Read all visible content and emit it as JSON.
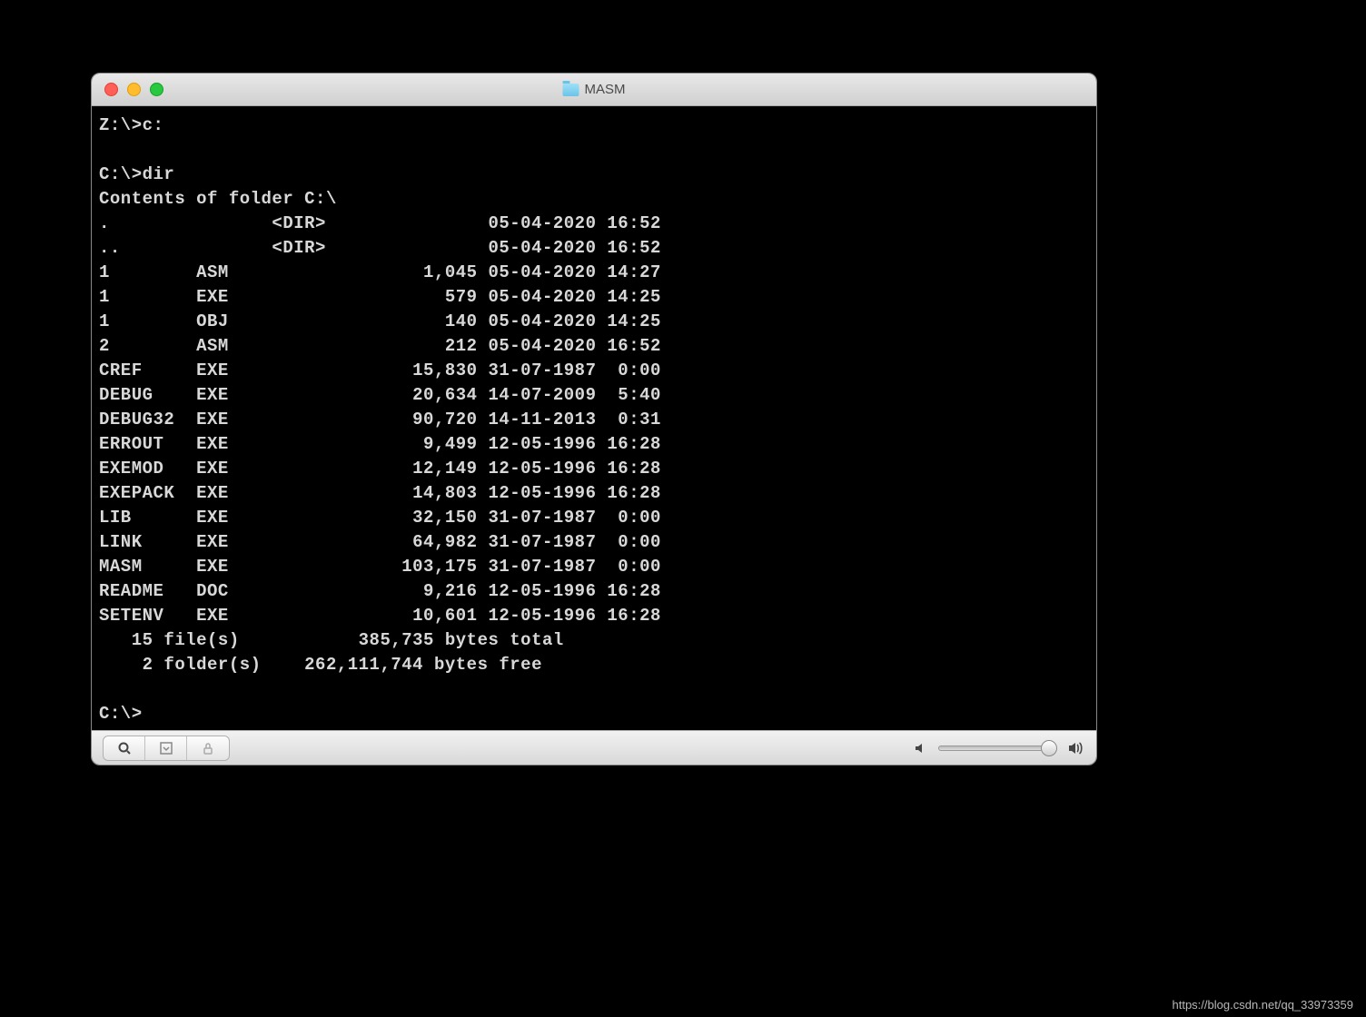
{
  "window": {
    "title": "MASM"
  },
  "terminal": {
    "prompt1": "Z:\\>c:",
    "prompt2": "C:\\>dir",
    "header": "Contents of folder C:\\",
    "entries": [
      {
        "name": ".",
        "ext": "",
        "dir": true,
        "size": "",
        "date": "05-04-2020",
        "time": "16:52"
      },
      {
        "name": "..",
        "ext": "",
        "dir": true,
        "size": "",
        "date": "05-04-2020",
        "time": "16:52"
      },
      {
        "name": "1",
        "ext": "ASM",
        "dir": false,
        "size": "1,045",
        "date": "05-04-2020",
        "time": "14:27"
      },
      {
        "name": "1",
        "ext": "EXE",
        "dir": false,
        "size": "579",
        "date": "05-04-2020",
        "time": "14:25"
      },
      {
        "name": "1",
        "ext": "OBJ",
        "dir": false,
        "size": "140",
        "date": "05-04-2020",
        "time": "14:25"
      },
      {
        "name": "2",
        "ext": "ASM",
        "dir": false,
        "size": "212",
        "date": "05-04-2020",
        "time": "16:52"
      },
      {
        "name": "CREF",
        "ext": "EXE",
        "dir": false,
        "size": "15,830",
        "date": "31-07-1987",
        "time": " 0:00"
      },
      {
        "name": "DEBUG",
        "ext": "EXE",
        "dir": false,
        "size": "20,634",
        "date": "14-07-2009",
        "time": " 5:40"
      },
      {
        "name": "DEBUG32",
        "ext": "EXE",
        "dir": false,
        "size": "90,720",
        "date": "14-11-2013",
        "time": " 0:31"
      },
      {
        "name": "ERROUT",
        "ext": "EXE",
        "dir": false,
        "size": "9,499",
        "date": "12-05-1996",
        "time": "16:28"
      },
      {
        "name": "EXEMOD",
        "ext": "EXE",
        "dir": false,
        "size": "12,149",
        "date": "12-05-1996",
        "time": "16:28"
      },
      {
        "name": "EXEPACK",
        "ext": "EXE",
        "dir": false,
        "size": "14,803",
        "date": "12-05-1996",
        "time": "16:28"
      },
      {
        "name": "LIB",
        "ext": "EXE",
        "dir": false,
        "size": "32,150",
        "date": "31-07-1987",
        "time": " 0:00"
      },
      {
        "name": "LINK",
        "ext": "EXE",
        "dir": false,
        "size": "64,982",
        "date": "31-07-1987",
        "time": " 0:00"
      },
      {
        "name": "MASM",
        "ext": "EXE",
        "dir": false,
        "size": "103,175",
        "date": "31-07-1987",
        "time": " 0:00"
      },
      {
        "name": "README",
        "ext": "DOC",
        "dir": false,
        "size": "9,216",
        "date": "12-05-1996",
        "time": "16:28"
      },
      {
        "name": "SETENV",
        "ext": "EXE",
        "dir": false,
        "size": "10,601",
        "date": "12-05-1996",
        "time": "16:28"
      }
    ],
    "summary1_count": "15",
    "summary1_label": "file(s)",
    "summary1_bytes": "385,735",
    "summary1_tail": "bytes total",
    "summary2_count": "2",
    "summary2_label": "folder(s)",
    "summary2_bytes": "262,111,744",
    "summary2_tail": "bytes free",
    "prompt3": "C:\\>"
  },
  "watermark": "https://blog.csdn.net/qq_33973359"
}
